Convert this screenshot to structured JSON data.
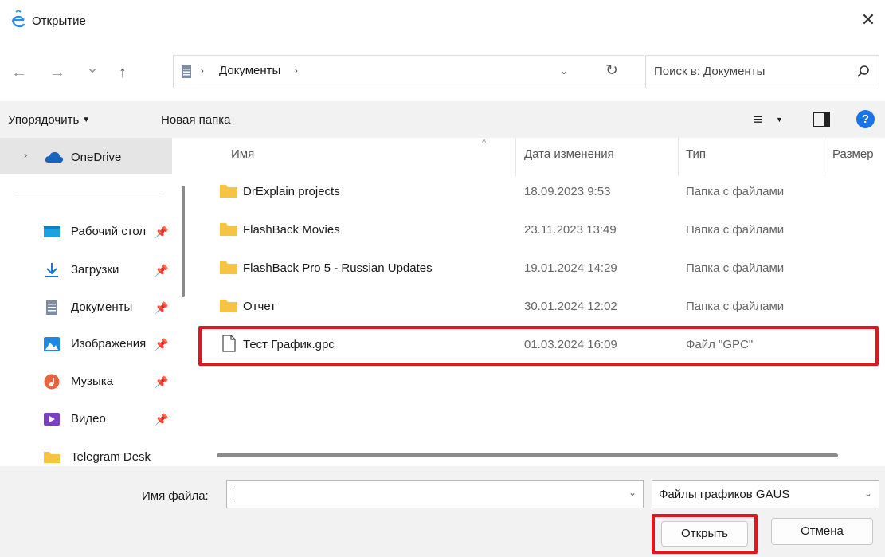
{
  "window": {
    "title": "Открытие",
    "close_symbol": "✕"
  },
  "nav": {
    "back_symbol": "←",
    "forward_symbol": "→",
    "recent_symbol": "⌄",
    "up_symbol": "↑",
    "breadcrumb_sep": "›",
    "breadcrumb": "Документы",
    "dropdown_symbol": "⌄",
    "refresh_symbol": "↻",
    "search_placeholder": "Поиск в: Документы"
  },
  "toolbar": {
    "organize_label": "Упорядочить",
    "organize_caret": "▼",
    "new_folder_label": "Новая папка",
    "view_lines": "≡",
    "view_caret": "▼",
    "help_symbol": "?"
  },
  "sidebar": {
    "chevron": "›",
    "onedrive_label": "OneDrive",
    "pin_symbol": "📌",
    "items": [
      {
        "label": "Рабочий стол",
        "icon": "desktop-icon",
        "pinned": true
      },
      {
        "label": "Загрузки",
        "icon": "downloads-icon",
        "pinned": true
      },
      {
        "label": "Документы",
        "icon": "documents-icon",
        "pinned": true
      },
      {
        "label": "Изображения",
        "icon": "pictures-icon",
        "pinned": true
      },
      {
        "label": "Музыка",
        "icon": "music-icon",
        "pinned": true
      },
      {
        "label": "Видео",
        "icon": "video-icon",
        "pinned": true
      },
      {
        "label": "Telegram Desktop",
        "icon": "folder-icon",
        "pinned": false
      }
    ]
  },
  "columns": {
    "name": "Имя",
    "date": "Дата изменения",
    "type": "Тип",
    "size": "Размер",
    "sort_arrow": "^"
  },
  "files": [
    {
      "name": "DrExplain projects",
      "date": "18.09.2023 9:53",
      "type": "Папка с файлами",
      "kind": "folder"
    },
    {
      "name": "FlashBack Movies",
      "date": "23.11.2023 13:49",
      "type": "Папка с файлами",
      "kind": "folder"
    },
    {
      "name": "FlashBack Pro 5 - Russian Updates",
      "date": "19.01.2024 14:29",
      "type": "Папка с файлами",
      "kind": "folder"
    },
    {
      "name": "Отчет",
      "date": "30.01.2024 12:02",
      "type": "Папка с файлами",
      "kind": "folder"
    },
    {
      "name": "Тест График.gpc",
      "date": "01.03.2024 16:09",
      "type": "Файл \"GPC\"",
      "kind": "file"
    }
  ],
  "bottom": {
    "filename_label": "Имя файла:",
    "filename_value": "",
    "dropdown_symbol": "⌄",
    "filter_value": "Файлы графиков GAUS",
    "open_label": "Открыть",
    "cancel_label": "Отмена"
  },
  "colors": {
    "highlight": "#e6141b",
    "folder": "#f5c542",
    "accent": "#1a73e8",
    "toolbar_bg": "#f2f2f2"
  }
}
